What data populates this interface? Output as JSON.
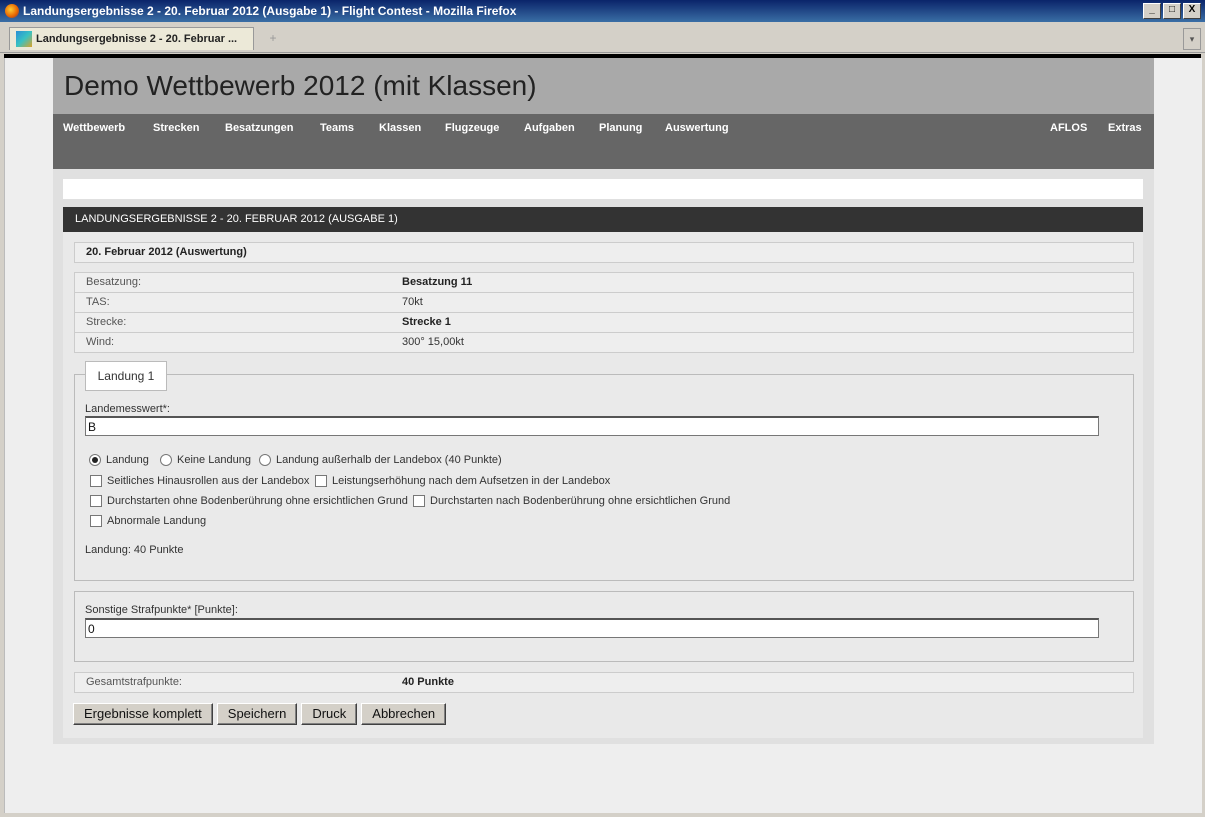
{
  "window": {
    "title": "Landungsergebnisse 2 - 20. Februar 2012 (Ausgabe 1) - Flight Contest - Mozilla Firefox",
    "controls": [
      "_",
      "□",
      "X"
    ]
  },
  "tab": {
    "label": "Landungsergebnisse 2 - 20. Februar ...",
    "new_tab_glyph": "+",
    "menu_glyph": "▾"
  },
  "header": {
    "title": "Demo Wettbewerb 2012 (mit Klassen)"
  },
  "nav": {
    "left": [
      "Wettbewerb",
      "Strecken",
      "Besatzungen",
      "Teams",
      "Klassen",
      "Flugzeuge",
      "Aufgaben",
      "Planung",
      "Auswertung"
    ],
    "right": [
      "AFLOS",
      "Extras"
    ]
  },
  "section": {
    "heading": "LANDUNGSERGEBNISSE 2 - 20. FEBRUAR 2012 (AUSGABE 1)",
    "date_line": "20. Februar 2012 (Auswertung)"
  },
  "info": [
    {
      "label": "Besatzung:",
      "value": "Besatzung 11",
      "bold": true
    },
    {
      "label": "TAS:",
      "value": "70kt",
      "bold": false
    },
    {
      "label": "Strecke:",
      "value": "Strecke 1",
      "bold": true
    },
    {
      "label": "Wind:",
      "value": "300° 15,00kt",
      "bold": false
    }
  ],
  "landing": {
    "legend": "Landung 1",
    "measure_label": "Landemesswert*:",
    "measure_value": "B",
    "radios": [
      {
        "label": "Landung",
        "checked": true
      },
      {
        "label": "Keine Landung",
        "checked": false
      },
      {
        "label": "Landung außerhalb der Landebox (40 Punkte)",
        "checked": false
      }
    ],
    "checkboxes": [
      "Seitliches Hinausrollen aus der Landebox",
      "Leistungserhöhung nach dem Aufsetzen in der Landebox",
      "Durchstarten ohne Bodenberührung ohne ersichtlichen Grund",
      "Durchstarten nach Bodenberührung ohne ersichtlichen Grund",
      "Abnormale Landung"
    ],
    "result": "Landung: 40 Punkte"
  },
  "other": {
    "label": "Sonstige Strafpunkte* [Punkte]:",
    "value": "0"
  },
  "total": {
    "label": "Gesamtstrafpunkte:",
    "value": "40 Punkte"
  },
  "buttons": [
    "Ergebnisse komplett",
    "Speichern",
    "Druck",
    "Abbrechen"
  ]
}
